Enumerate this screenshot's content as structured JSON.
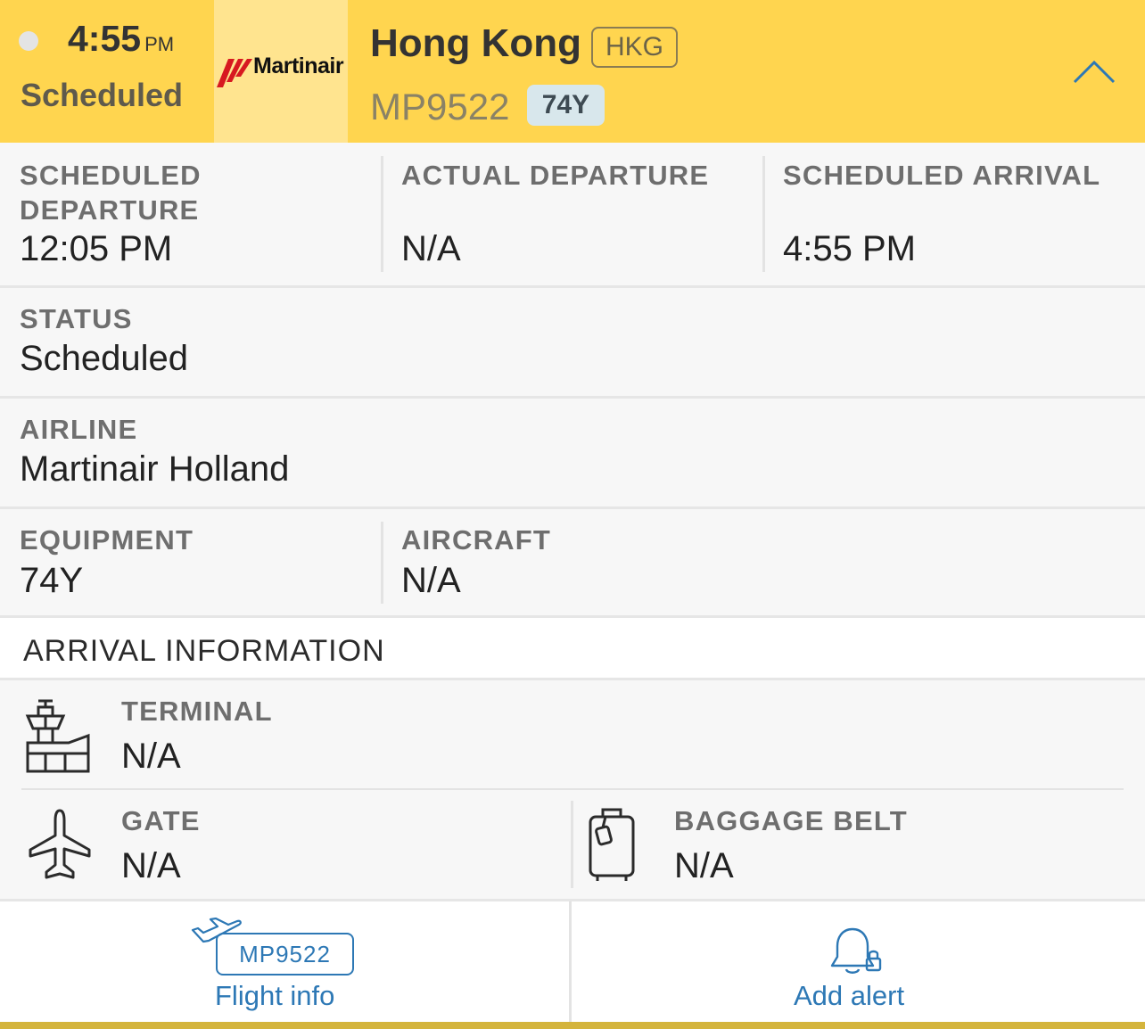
{
  "header": {
    "time": "4:55",
    "time_suffix": "PM",
    "status": "Scheduled",
    "airline_logo_text": "Martinair",
    "destination_city": "Hong Kong",
    "destination_code": "HKG",
    "flight_number": "MP9522",
    "equipment_code": "74Y",
    "colors": {
      "background": "#ffd54f",
      "logo_panel": "#ffe48f",
      "logo_mark": "#d71920"
    }
  },
  "times": {
    "scheduled_departure": {
      "label": "SCHEDULED DEPARTURE",
      "value": "12:05 PM"
    },
    "actual_departure": {
      "label": "ACTUAL DEPARTURE",
      "value": "N/A"
    },
    "scheduled_arrival": {
      "label": "SCHEDULED ARRIVAL",
      "value": "4:55 PM"
    }
  },
  "status": {
    "label": "STATUS",
    "value": "Scheduled"
  },
  "airline": {
    "label": "AIRLINE",
    "value": "Martinair Holland"
  },
  "equipment": {
    "label": "EQUIPMENT",
    "value": "74Y"
  },
  "aircraft": {
    "label": "AIRCRAFT",
    "value": "N/A"
  },
  "arrival_info": {
    "title": "ARRIVAL INFORMATION",
    "terminal": {
      "label": "TERMINAL",
      "value": "N/A",
      "icon": "control-tower-icon"
    },
    "gate": {
      "label": "GATE",
      "value": "N/A",
      "icon": "airplane-icon"
    },
    "baggage": {
      "label": "BAGGAGE BELT",
      "value": "N/A",
      "icon": "luggage-icon"
    }
  },
  "bottom_bar": {
    "flight_info": {
      "badge": "MP9522",
      "label": "Flight info",
      "icon": "plane-takeoff-icon"
    },
    "add_alert": {
      "label": "Add alert",
      "icon": "bell-lock-icon"
    },
    "accent": "#2d78b5"
  }
}
